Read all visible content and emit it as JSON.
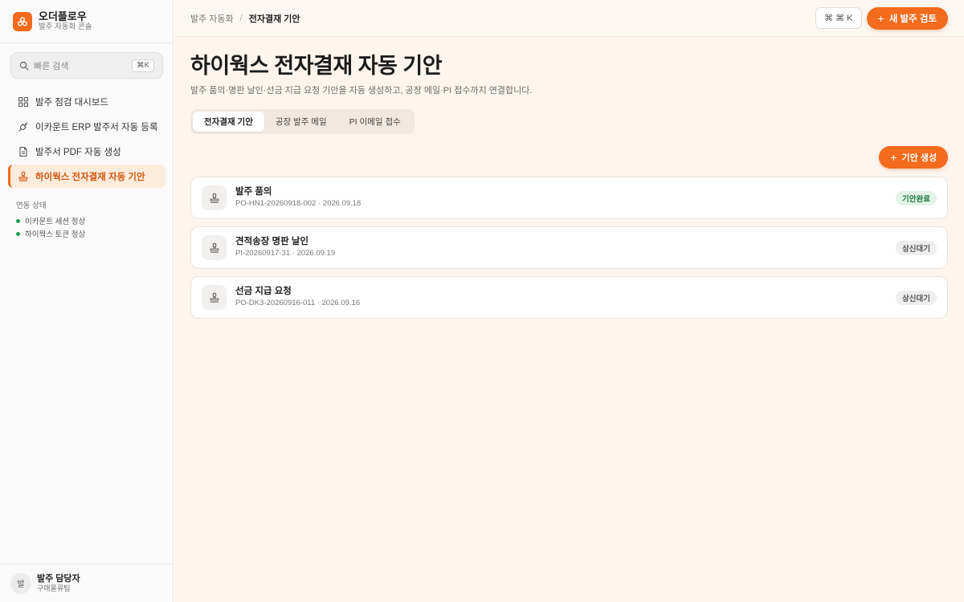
{
  "brand": {
    "name": "오더플로우",
    "subtitle": "발주 자동화 콘솔"
  },
  "search": {
    "placeholder": "빠른 검색",
    "shortcut": "⌘K"
  },
  "sidebar": {
    "items": [
      {
        "label": "발주 점검 대시보드",
        "icon": "grid-icon"
      },
      {
        "label": "이카운트 ERP 발주서 자동 등록",
        "icon": "plug-icon"
      },
      {
        "label": "발주서 PDF 자동 생성",
        "icon": "document-icon"
      },
      {
        "label": "하이웍스 전자결재 자동 기안",
        "icon": "stamp-icon",
        "active": true
      }
    ],
    "status": {
      "title": "연동 상태",
      "rows": [
        "이카운트 세션 정상",
        "하이웍스 토큰 정상"
      ],
      "color": "#1f9d55"
    }
  },
  "user": {
    "avatar": "발",
    "name": "발주 담당자",
    "role": "구매물류팀"
  },
  "topbar": {
    "breadcrumb": [
      "발주 자동화",
      "전자결재 기안"
    ],
    "shortcut": "⌘ ⌘ K",
    "primary_action": "새 발주 검토"
  },
  "page": {
    "title": "하이웍스 전자결재 자동 기안",
    "description": "발주 품의·명판 날인·선금 지급 요청 기안을 자동 생성하고, 공장 메일·PI 접수까지 연결합니다."
  },
  "tabs": [
    "전자결재 기안",
    "공장 발주 메일",
    "PI 이메일 접수"
  ],
  "actions": {
    "create": "기안 생성"
  },
  "documents": [
    {
      "title": "발주 품의",
      "meta": "PO-HN1-20260918-002 · 2026.09.18",
      "status": "기안완료"
    },
    {
      "title": "견적송장 명판 날인",
      "meta": "PI-20260917-31 · 2026.09.19",
      "status": "상신대기"
    },
    {
      "title": "선금 지급 요청",
      "meta": "PO-DK3-20260916-011 · 2026.09.16",
      "status": "상신대기"
    }
  ],
  "colors": {
    "accent": "#f36b1c",
    "done": "#1e7a3f",
    "background": "#fdf5ee"
  }
}
